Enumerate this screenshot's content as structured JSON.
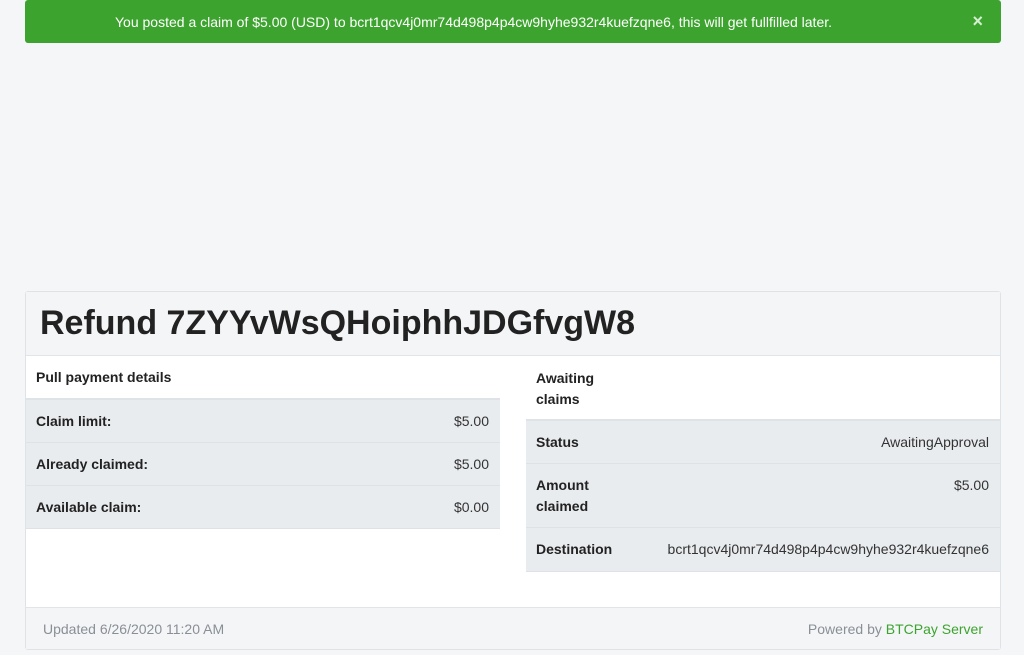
{
  "alert": {
    "message": "You posted a claim of $5.00 (USD) to bcrt1qcv4j0mr74d498p4p4cw9hyhe932r4kuefzqne6, this will get fullfilled later.",
    "close_label": "×",
    "color": "#3ca42e"
  },
  "title": "Refund 7ZYYvWsQHoiphhJDGfvgW8",
  "pull_payment": {
    "heading": "Pull payment details",
    "rows": [
      {
        "label": "Claim limit:",
        "value": "$5.00"
      },
      {
        "label": "Already claimed:",
        "value": "$5.00"
      },
      {
        "label": "Available claim:",
        "value": "$0.00"
      }
    ]
  },
  "awaiting": {
    "heading": "Awaiting claims",
    "rows": [
      {
        "label": "Status",
        "value": "AwaitingApproval"
      },
      {
        "label": "Amount claimed",
        "value": "$5.00"
      },
      {
        "label": "Destination",
        "value": "bcrt1qcv4j0mr74d498p4p4cw9hyhe932r4kuefzqne6"
      }
    ]
  },
  "footer": {
    "updated": "Updated 6/26/2020 11:20 AM",
    "powered_prefix": "Powered by",
    "brand": "BTCPay Server"
  }
}
